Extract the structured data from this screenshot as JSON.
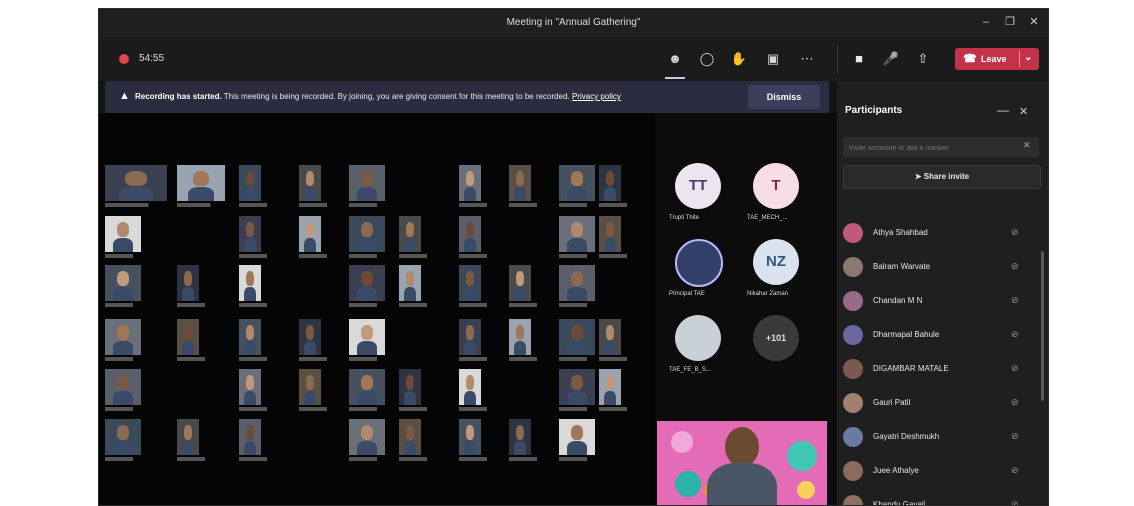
{
  "window": {
    "title": "Meeting in \"Annual Gathering\""
  },
  "toolbar": {
    "timer": "54:55"
  },
  "controls": {
    "leave_label": "Leave"
  },
  "banner": {
    "bold": "Recording has started.",
    "message": "This meeting is being recorded. By joining, you are giving consent for this meeting to be recorded.",
    "link": "Privacy policy",
    "dismiss": "Dismiss"
  },
  "gallery": {
    "avatars": [
      {
        "initials": "TT",
        "name": "Trupti Thite",
        "bg": "#ece4f1",
        "fg": "#4b3a6b"
      },
      {
        "initials": "T",
        "name": "TAE_MECH_...",
        "bg": "#f6dde6",
        "fg": "#7a2a45"
      },
      {
        "initials": "",
        "name": "Principal TAE",
        "bg": "#33406a",
        "fg": "#ffffff"
      },
      {
        "initials": "NZ",
        "name": "Nikahar Zaman",
        "bg": "#dbe4ee",
        "fg": "#35557a"
      },
      {
        "initials": "",
        "name": "TAE_FE_B_S...",
        "bg": "#c9d0d8",
        "fg": "#333333"
      },
      {
        "initials": "+101",
        "name": "",
        "bg": "#3a3a3a",
        "fg": "#e0e0e0"
      }
    ]
  },
  "panel": {
    "title": "Participants",
    "invite_placeholder": "Invite someone or dial a number",
    "share_label": "Share invite",
    "participants": [
      {
        "name": "Athya Shahbad",
        "color": "#c05a7a"
      },
      {
        "name": "Balram Warvate",
        "color": "#8a7a70"
      },
      {
        "name": "Chandan M N",
        "color": "#9a6a8a"
      },
      {
        "name": "Dharmapal Bahule",
        "color": "#6a6aa0"
      },
      {
        "name": "DIGAMBAR MATALE",
        "color": "#7a5a50"
      },
      {
        "name": "Gauri Patil",
        "color": "#a08070"
      },
      {
        "name": "Gayatri Deshmukh",
        "color": "#6a7aa0"
      },
      {
        "name": "Juee Athalye",
        "color": "#8a6a5a"
      },
      {
        "name": "Khandu Gavali",
        "color": "#907060"
      }
    ]
  }
}
